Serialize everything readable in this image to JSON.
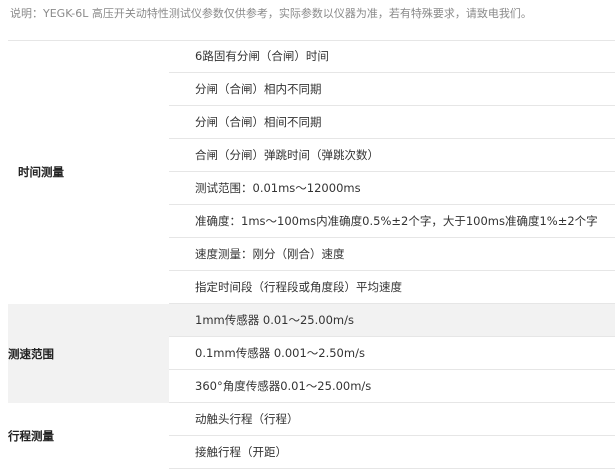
{
  "note": "说明：YEGK-6L 高压开关动特性测试仪参数仅供参考，实际参数以仪器为准，若有特殊要求，请致电我们。",
  "groups": [
    {
      "title": "时间测量",
      "rows": [
        "6路固有分闸（合闸）时间",
        "分闸（合闸）相内不同期",
        "分闸（合闸）相间不同期",
        "合闸（分闸）弹跳时间（弹跳次数）",
        "测试范围：0.01ms～12000ms",
        "准确度：1ms～100ms内准确度0.5%±2个字，大于100ms准确度1%±2个字",
        "速度测量：刚分（刚合）速度",
        "指定时间段（行程段或角度段）平均速度"
      ]
    },
    {
      "title": "测速范围",
      "rows": [
        "1mm传感器 0.01～25.00m/s",
        "0.1mm传感器 0.001～2.50m/s",
        "360°角度传感器0.01～25.00m/s"
      ]
    },
    {
      "title": "行程测量",
      "rows": [
        "动触头行程（行程）",
        "接触行程（开距）"
      ]
    }
  ]
}
